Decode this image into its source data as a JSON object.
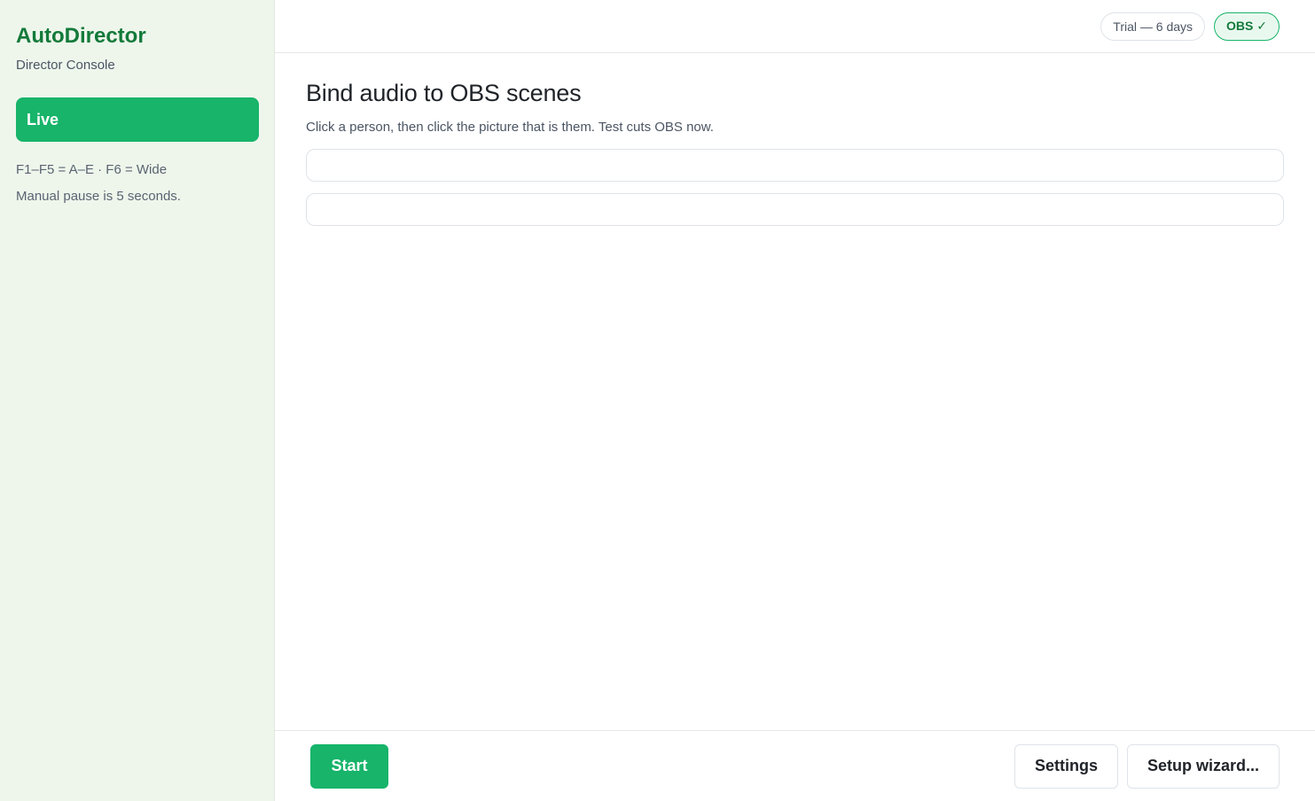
{
  "sidebar": {
    "app_name": "AutoDirector",
    "app_subtitle": "Director Console",
    "nav_live": "Live",
    "hint_keys": "F1–F5 = A–E · F6 = Wide",
    "hint_pause": "Manual pause is 5 seconds."
  },
  "topbar": {
    "trial_badge": "Trial — 6 days",
    "obs_badge": "OBS ✓"
  },
  "main": {
    "title": "Bind audio to OBS scenes",
    "subtitle": "Click a person, then click the picture that is them. Test cuts OBS now."
  },
  "footer": {
    "start_label": "Start",
    "settings_label": "Settings",
    "wizard_label": "Setup wizard..."
  },
  "colors": {
    "accent": "#17b46a",
    "brand": "#137a3a",
    "sidebar_bg": "#eef6ec"
  }
}
